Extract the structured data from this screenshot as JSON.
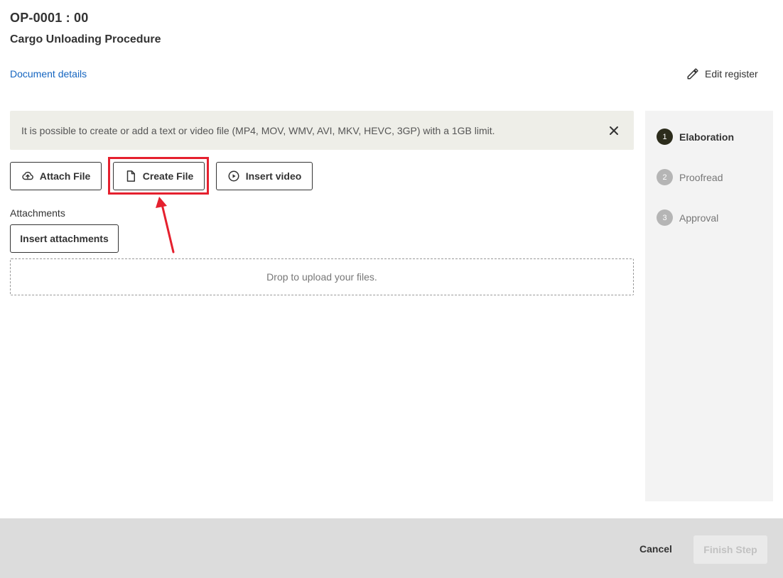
{
  "header": {
    "code": "OP-0001 : 00",
    "title": "Cargo Unloading Procedure",
    "details_link": "Document details",
    "edit_register": "Edit register"
  },
  "banner": {
    "text": "It is possible to create or add a text or video file (MP4, MOV, WMV, AVI, MKV, HEVC, 3GP) with a 1GB limit."
  },
  "actions": {
    "attach_file": "Attach File",
    "create_file": "Create File",
    "insert_video": "Insert video"
  },
  "attachments": {
    "label": "Attachments",
    "insert_button": "Insert attachments",
    "drop_text": "Drop to upload your files."
  },
  "steps": [
    {
      "number": "1",
      "label": "Elaboration",
      "state": "active"
    },
    {
      "number": "2",
      "label": "Proofread",
      "state": "pending"
    },
    {
      "number": "3",
      "label": "Approval",
      "state": "pending"
    }
  ],
  "footer": {
    "cancel": "Cancel",
    "finish": "Finish Step"
  },
  "colors": {
    "link": "#1565c0",
    "highlight": "#e5202e",
    "active_step": "#2c2c1c",
    "banner_bg": "#eeeee8"
  },
  "icons": {
    "edit": "pencil-icon",
    "close": "close-icon",
    "attach": "cloud-upload-icon",
    "create": "file-icon",
    "video": "play-circle-icon"
  }
}
